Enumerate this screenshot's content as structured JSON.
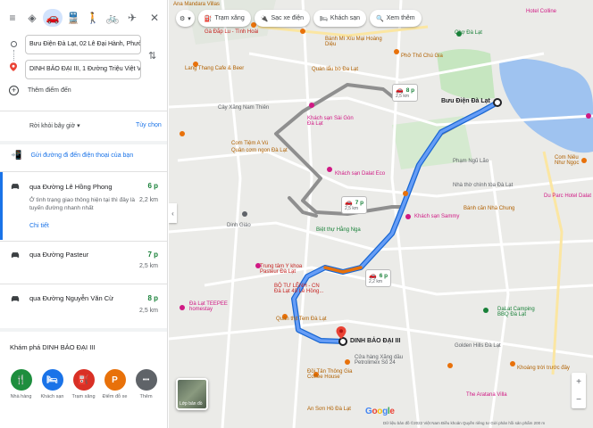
{
  "panel": {
    "origin": "Bưu Điện Đà Lạt, 02 Lê Đại Hành, Phường",
    "destination": "DINH BẢO ĐẠI III, 1 Đường Triệu Việt Vươ",
    "add_destination": "Thêm điểm đến",
    "depart": "Rời khỏi bây giờ",
    "options": "Tùy chọn",
    "send_to_phone": "Gửi đường đi đến điện thoại của bạn",
    "routes": [
      {
        "name": "qua Đường Lê Hồng Phong",
        "time": "6 p",
        "distance": "2,2 km",
        "desc": "Ở tình trạng giao thông hiện tại thì đây là tuyến đường nhanh nhất",
        "details": "Chi tiết"
      },
      {
        "name": "qua Đường Pasteur",
        "time": "7 p",
        "distance": "2,5 km"
      },
      {
        "name": "qua Đường Nguyễn Văn Cừ",
        "time": "8 p",
        "distance": "2,5 km"
      }
    ],
    "explore_title": "Khám phá DINH BẢO ĐẠI III",
    "categories": [
      {
        "label": "Nhà hàng",
        "icon": "restaurant-icon",
        "glyph": "🍴",
        "color": "#1e8e3e"
      },
      {
        "label": "Khách sạn",
        "icon": "hotel-icon",
        "glyph": "🛏",
        "color": "#1a73e8"
      },
      {
        "label": "Trạm xăng",
        "icon": "gas-icon",
        "glyph": "⛽",
        "color": "#d93025"
      },
      {
        "label": "Điểm đỗ xe",
        "icon": "parking-icon",
        "glyph": "P",
        "color": "#e8710a"
      },
      {
        "label": "Thêm",
        "icon": "more-icon",
        "glyph": "•••",
        "color": "#5f6368"
      }
    ]
  },
  "map": {
    "chips": [
      {
        "label": "Trạm xăng",
        "icon": "gas-icon"
      },
      {
        "label": "Sạc xe điện",
        "icon": "ev-charging-icon"
      },
      {
        "label": "Khách sạn",
        "icon": "hotel-icon"
      },
      {
        "label": "Xem thêm",
        "icon": "search-icon"
      }
    ],
    "route_boxes": [
      {
        "time": "8 p",
        "distance": "2,5 km"
      },
      {
        "time": "7 p",
        "distance": "2,5 km"
      },
      {
        "time": "6 p",
        "distance": "2,2 km"
      }
    ],
    "origin_label": "Bưu Điện Đà Lạt",
    "destination_label": "DINH BẢO ĐẠI III",
    "layer_label": "Lớp bản đồ",
    "brand": "Google",
    "footer": "Dữ liệu bản đồ ©2022   Việt Nam   Điều khoản   Quyền riêng tư   Gửi phản hồi sản phẩm   200 m",
    "labels": [
      "Ana Mandara Villas",
      "Hotel Colline",
      "Gà Đắp Lu - Tình Hoài",
      "Chợ Đà Lạt",
      "Bánh Mì Xíu Mại Hoàng Diệu",
      "Phở Thố Chú Gia",
      "Lang Thang Cafe & Beer",
      "Quán lẩu bò Đa Lạt",
      "Cây Xăng Nam Thiên",
      "Khách sạn Sài Gòn Đà Lạt",
      "Com Tiệm A Vú",
      "Quân cơm ngon Đà Lạt",
      "Khách sạn Dalat Eco",
      "Nhà thờ chính tòa Đà Lạt",
      "Du Parc Hotel Dalat",
      "Bánh căn Nhà Chung",
      "Khách sạn Sammy",
      "Biệt thự Hằng Nga",
      "Trung tâm Y khoa Pasteur Đà Lạt",
      "BỘ TƯ LỆNH - CN Đà Lạt 49 Lê Hồng...",
      "Đà Lạt TEEPEE homestay",
      "Quán thịt Tem Đà Lạt",
      "Cửa hàng Xăng dầu Petrolimex Số 24",
      "Đồi Tân Thông Gia Coffee House",
      "Golden Hills Đà Lạt",
      "Khoáng trời trước đây",
      "The Aratana Villa",
      "An Sơn Hồ Đà Lạt",
      "DaLat Camping BBQ Đà Lạt",
      "Com Niêu Như Ngọc",
      "Phạm Ngũ Lão",
      "Nhà thờ Tòa Đà Lạt",
      "Dinh Giáo"
    ]
  }
}
